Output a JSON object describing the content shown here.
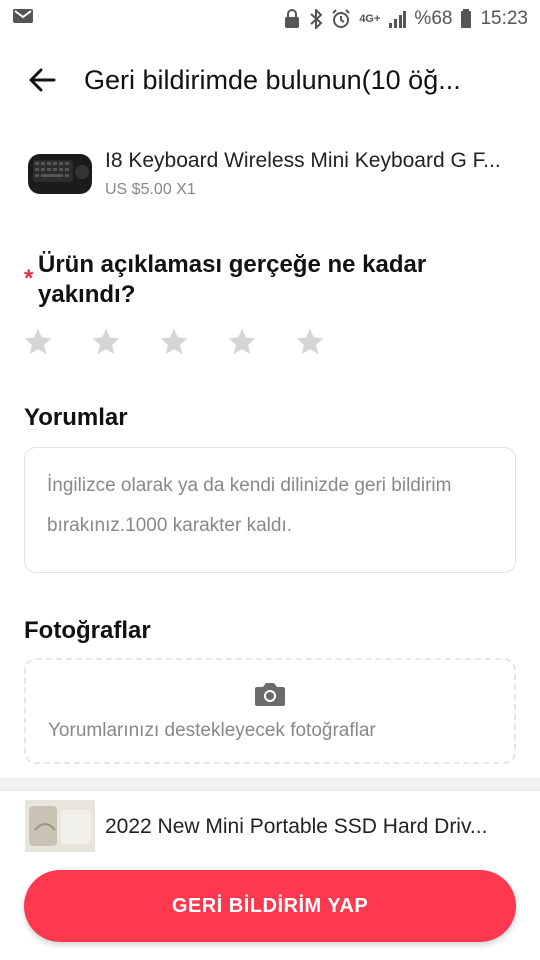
{
  "status_bar": {
    "network": "4G+",
    "battery": "%68",
    "time": "15:23"
  },
  "header": {
    "title": "Geri bildirimde bulunun(10 öğ..."
  },
  "product": {
    "name": "I8 Keyboard Wireless Mini Keyboard G F...",
    "price": "US $5.00 X1"
  },
  "rating": {
    "question": "Ürün açıklaması gerçeğe ne kadar yakındı?",
    "required_mark": "*",
    "max_stars": 5,
    "selected_stars": 0
  },
  "comments": {
    "title": "Yorumlar",
    "placeholder": "İngilizce olarak ya da kendi dilinizde geri bildirim bırakınız.1000 karakter kaldı."
  },
  "photos": {
    "title": "Fotoğraflar",
    "placeholder": "Yorumlarınızı destekleyecek fotoğraflar"
  },
  "next_product": {
    "name": "2022 New Mini Portable SSD Hard Driv..."
  },
  "submit": {
    "label": "GERİ BİLDİRİM YAP"
  },
  "colors": {
    "accent": "#fd384f",
    "star_empty": "#d5d5d5"
  }
}
